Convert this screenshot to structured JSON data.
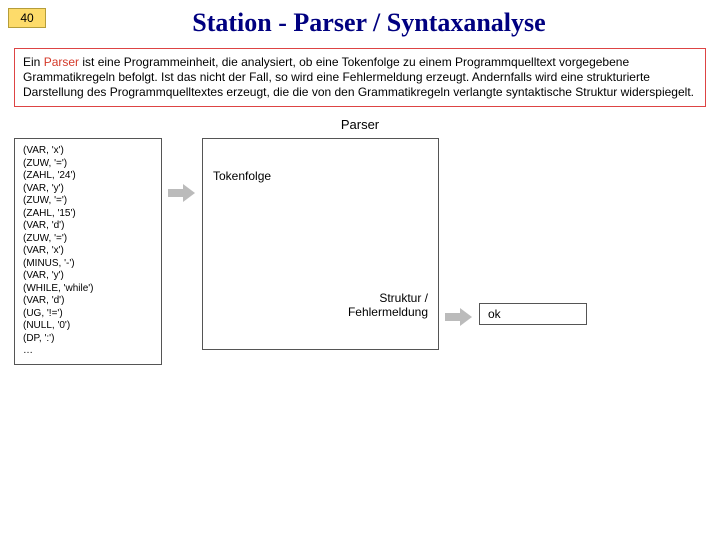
{
  "header": {
    "slide_number": "40",
    "title": "Station - Parser / Syntaxanalyse"
  },
  "definition": {
    "prefix": "Ein ",
    "highlight": "Parser",
    "rest": " ist eine Programmeinheit, die analysiert, ob eine Tokenfolge zu einem Programmquelltext vorgegebene Grammatikregeln befolgt. Ist das nicht der Fall, so wird eine Fehlermeldung erzeugt. Andernfalls wird eine strukturierte Darstellung des Programmquelltextes erzeugt, die die von den Grammatikregeln verlangte syntaktische Struktur widerspiegelt."
  },
  "diagram": {
    "parser_label": "Parser",
    "token_list": "(VAR, 'x')\n(ZUW, '=')\n(ZAHL, '24')\n(VAR, 'y')\n(ZUW, '=')\n(ZAHL, '15')\n(VAR, 'd')\n(ZUW, '=')\n(VAR, 'x')\n(MINUS, '-')\n(VAR, 'y')\n(WHILE, 'while')\n(VAR, 'd')\n(UG, '!=')\n(NULL, '0')\n(DP, ':')\n…",
    "input_label": "Tokenfolge",
    "output_label": "Struktur /\nFehlermeldung",
    "ok_label": "ok"
  }
}
